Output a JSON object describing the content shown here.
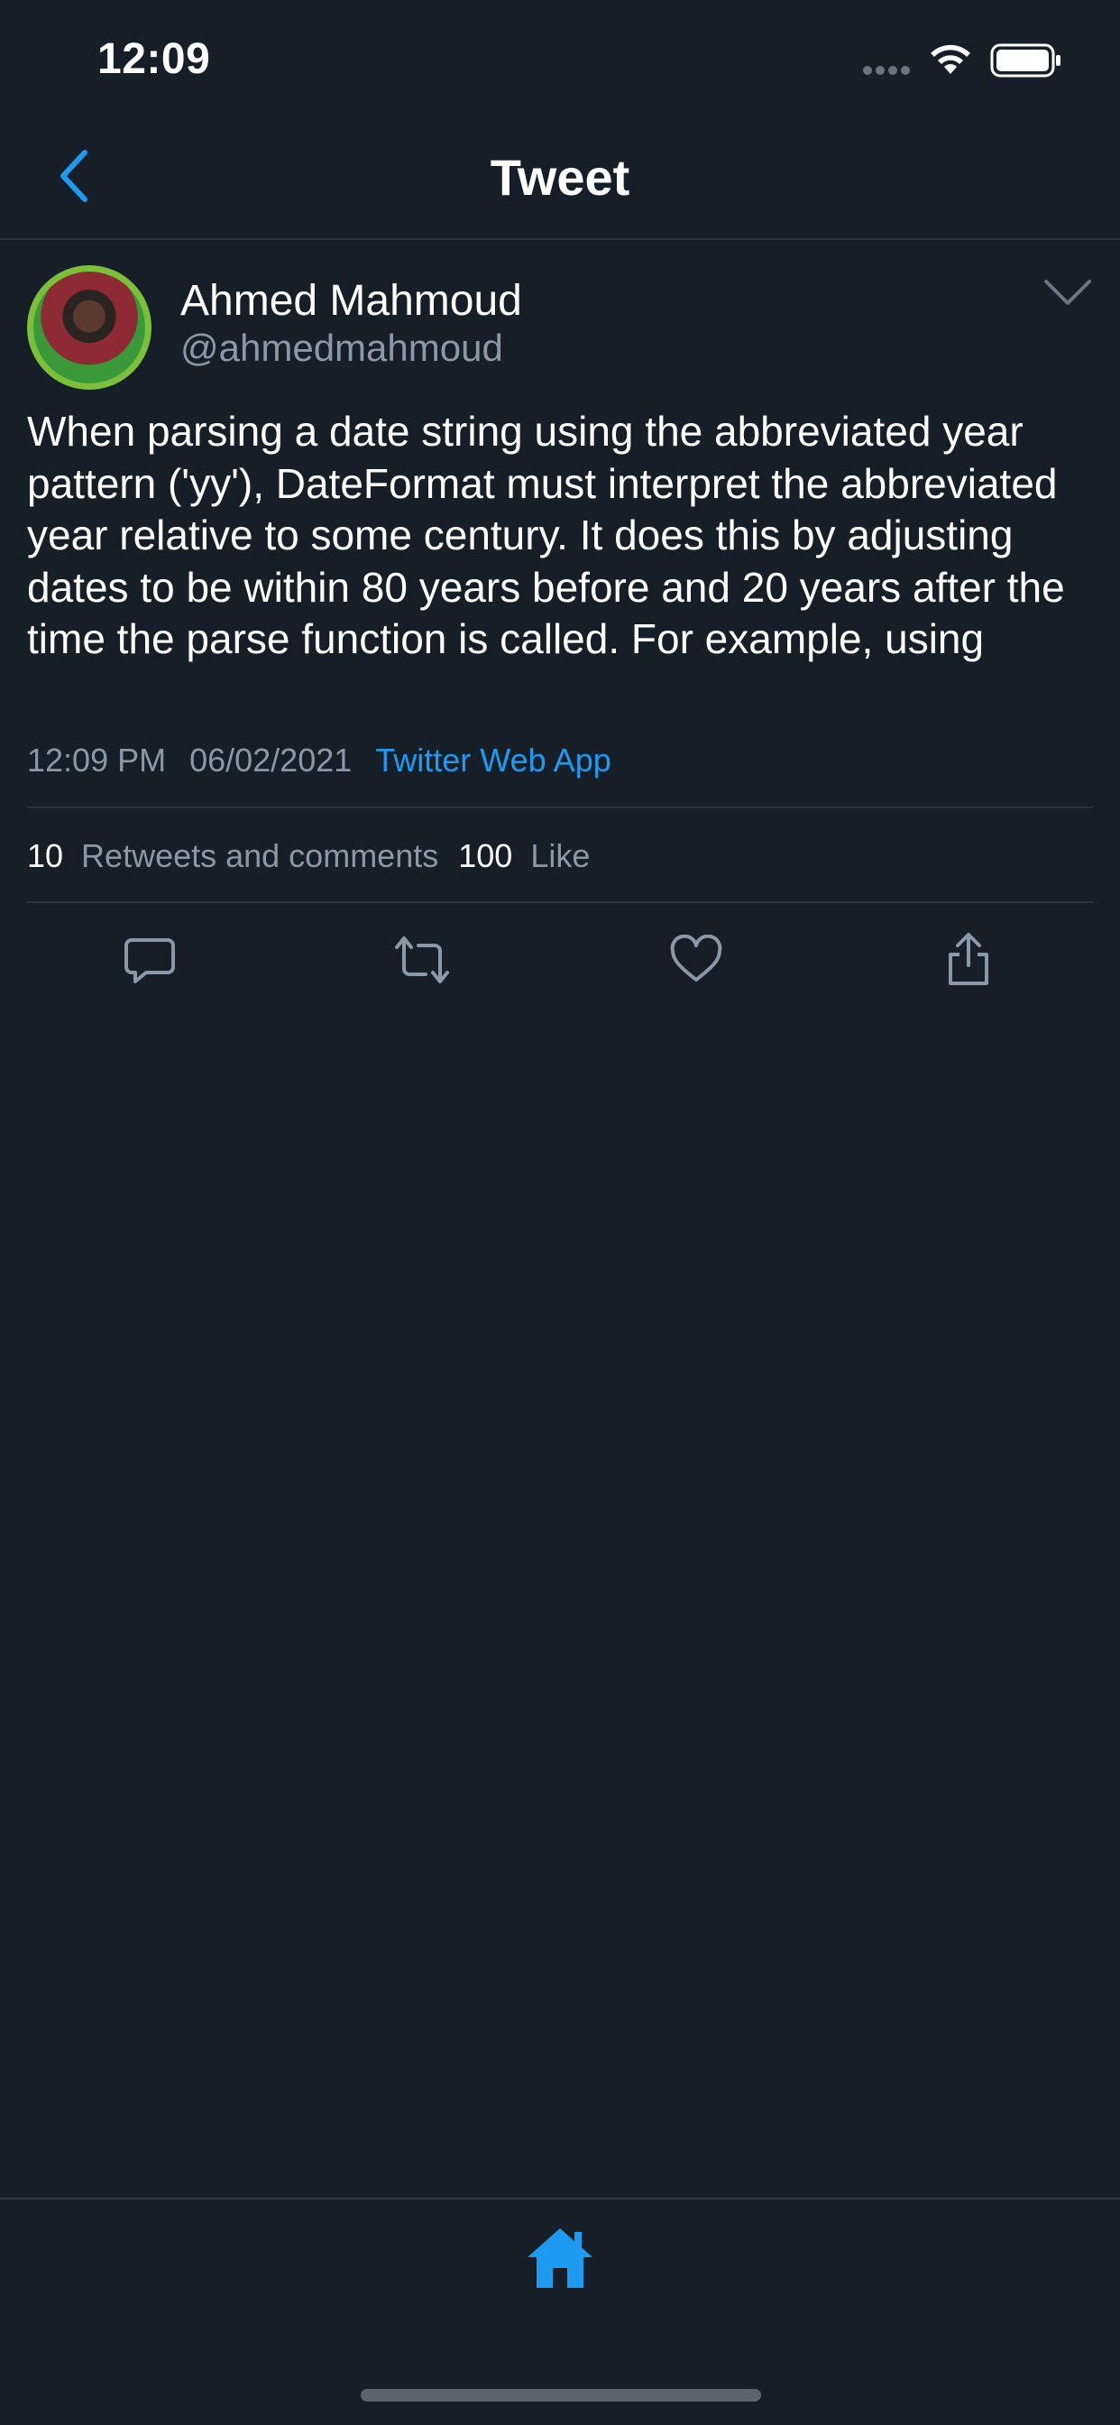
{
  "status_bar": {
    "time": "12:09"
  },
  "nav": {
    "title": "Tweet"
  },
  "tweet": {
    "author_name": "Ahmed Mahmoud",
    "author_handle": "@ahmedmahmoud",
    "text": "When parsing a date string using the abbreviated year pattern ('yy'), DateFormat must interpret the abbreviated year relative to some century. It does this by adjusting dates to be within 80 years before and 20 years after the time the parse function is called. For example, using",
    "time": "12:09 PM",
    "date": "06/02/2021",
    "source": "Twitter Web App",
    "retweets_count": "10",
    "retweets_label": "Retweets and comments",
    "likes_count": "100",
    "likes_label": "Like"
  },
  "icons": {
    "back": "chevron-left-icon",
    "more": "chevron-down-icon",
    "reply": "comment-icon",
    "retweet": "retweet-icon",
    "like": "heart-icon",
    "share": "share-icon",
    "home": "home-icon"
  },
  "colors": {
    "background": "#161e28",
    "accent": "#1d9bf0",
    "secondary_text": "#8b98a5",
    "divider": "#2a3440"
  }
}
